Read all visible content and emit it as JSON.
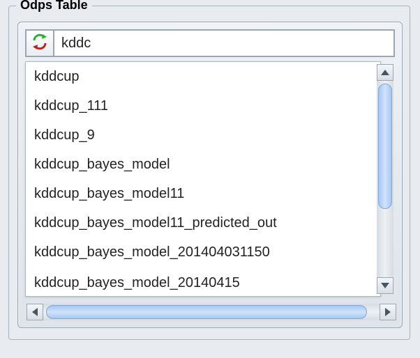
{
  "group": {
    "title": "Odps Table"
  },
  "search": {
    "value": "kddc"
  },
  "suggestions": [
    "kddcup",
    "kddcup_111",
    "kddcup_9",
    "kddcup_bayes_model",
    "kddcup_bayes_model11",
    "kddcup_bayes_model11_predicted_out",
    "kddcup_bayes_model_201404031150",
    "kddcup_bayes_model_20140415"
  ]
}
